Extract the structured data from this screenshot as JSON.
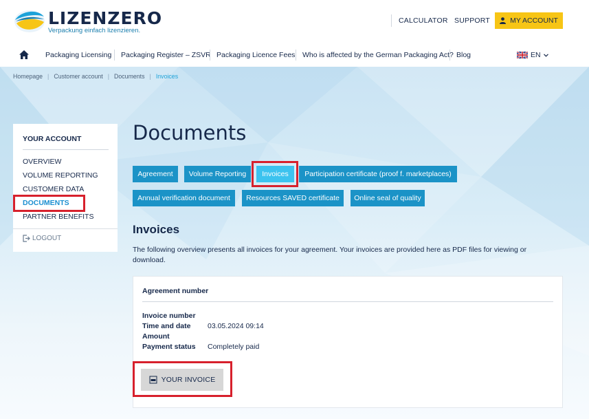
{
  "brand": {
    "name": "LIZENZERO",
    "tagline": "Verpackung einfach lizenzieren."
  },
  "header": {
    "calculator": "CALCULATOR",
    "support": "SUPPORT",
    "my_account": "MY ACCOUNT",
    "account_icon": "user-icon"
  },
  "nav": {
    "home_icon": "home-icon",
    "items": [
      "Packaging Licensing",
      "Packaging Register – ZSVR",
      "Packaging Licence Fees",
      "Who is affected by the German Packaging Act?",
      "Blog"
    ],
    "language": "EN",
    "language_icon": "uk-flag-icon"
  },
  "breadcrumb": [
    "Homepage",
    "Customer account",
    "Documents",
    "Invoices"
  ],
  "sidebar": {
    "title": "YOUR ACCOUNT",
    "items": [
      "OVERVIEW",
      "VOLUME REPORTING",
      "CUSTOMER DATA",
      "DOCUMENTS",
      "PARTNER BENEFITS"
    ],
    "active": "DOCUMENTS",
    "logout": "LOGOUT",
    "logout_icon": "logout-icon"
  },
  "main": {
    "title": "Documents",
    "tabs_row1": [
      "Agreement",
      "Volume Reporting",
      "Invoices",
      "Participation certificate (proof f. marketplaces)"
    ],
    "tabs_row2": [
      "Annual verification document",
      "Resources SAVED certificate",
      "Online seal of quality"
    ],
    "active_tab": "Invoices",
    "section_title": "Invoices",
    "section_desc": "The following overview presents all invoices for your agreement. Your invoices are provided here as PDF files for viewing or download."
  },
  "invoice_card": {
    "agreement_label": "Agreement number",
    "invoice_number_label": "Invoice number",
    "time_label": "Time and date",
    "time_value": "03.05.2024 09:14",
    "amount_label": "Amount",
    "status_label": "Payment status",
    "status_value": "Completely paid",
    "button_label": "YOUR INVOICE",
    "button_icon": "pdf-icon"
  },
  "colors": {
    "navy": "#16284a",
    "tab_blue": "#1b93c7",
    "tab_active": "#3cc3ef",
    "accent_yellow": "#f7c515",
    "highlight_red": "#d7202c"
  }
}
